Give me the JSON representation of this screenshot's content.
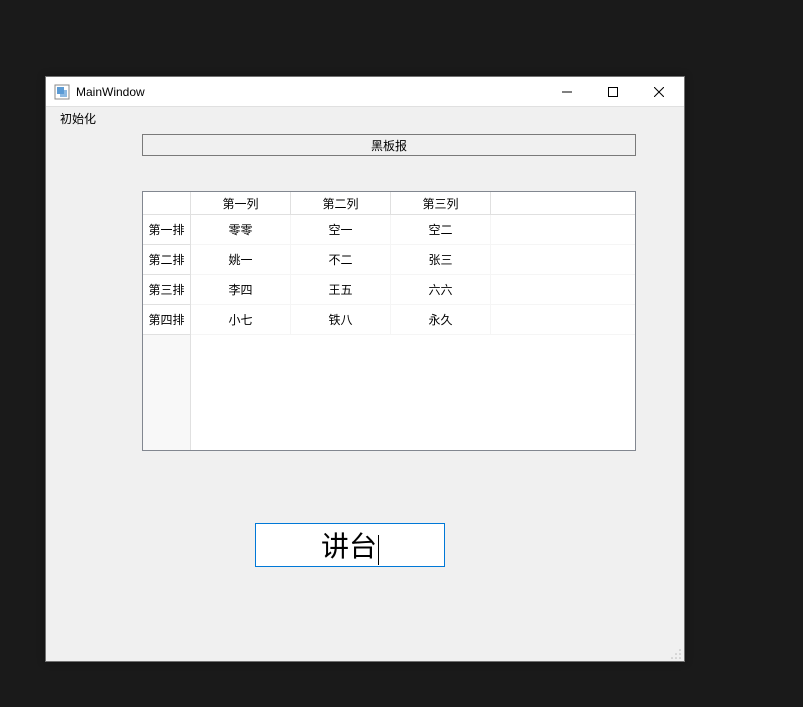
{
  "window": {
    "title": "MainWindow"
  },
  "menu": {
    "init": "初始化"
  },
  "blackboard": {
    "label": "黑板报"
  },
  "table": {
    "columns": [
      "第一列",
      "第二列",
      "第三列"
    ],
    "rows": [
      {
        "header": "第一排",
        "cells": [
          "零零",
          "空一",
          "空二"
        ]
      },
      {
        "header": "第二排",
        "cells": [
          "姚一",
          "不二",
          "张三"
        ]
      },
      {
        "header": "第三排",
        "cells": [
          "李四",
          "王五",
          "六六"
        ]
      },
      {
        "header": "第四排",
        "cells": [
          "小七",
          "铁八",
          "永久"
        ]
      }
    ]
  },
  "podium": {
    "text": "讲台"
  }
}
